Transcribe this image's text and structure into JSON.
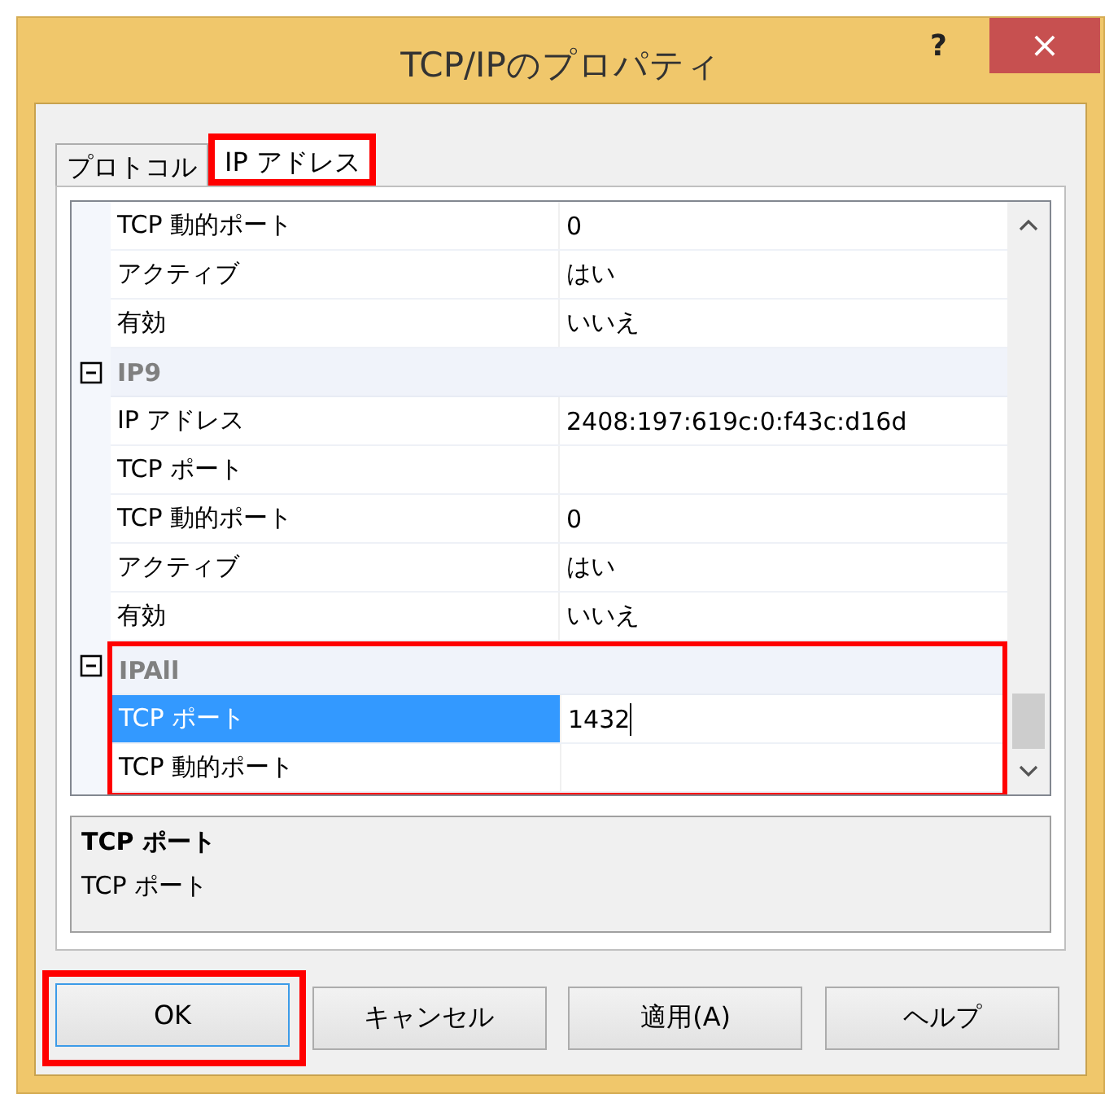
{
  "window": {
    "title": "TCP/IPのプロパティ",
    "help": "?",
    "close": "×"
  },
  "tabs": [
    {
      "label": "プロトコル",
      "selected": false,
      "highlighted": false
    },
    {
      "label": "IP アドレス",
      "selected": true,
      "highlighted": true
    }
  ],
  "grid": {
    "groups": [
      {
        "rows": [
          {
            "name": "TCP 動的ポート",
            "value": "0",
            "selected": false
          },
          {
            "name": "アクティブ",
            "value": "はい",
            "selected": false
          },
          {
            "name": "有効",
            "value": "いいえ",
            "selected": false
          }
        ]
      },
      {
        "title": "IP9",
        "expanded": true,
        "rows": [
          {
            "name": "IP アドレス",
            "value": "2408:197:619c:0:f43c:d16d",
            "selected": false
          },
          {
            "name": "TCP ポート",
            "value": "",
            "selected": false
          },
          {
            "name": "TCP 動的ポート",
            "value": "0",
            "selected": false
          },
          {
            "name": "アクティブ",
            "value": "はい",
            "selected": false
          },
          {
            "name": "有効",
            "value": "いいえ",
            "selected": false
          }
        ]
      },
      {
        "title": "IPAll",
        "expanded": true,
        "highlighted": true,
        "rows": [
          {
            "name": "TCP ポート",
            "value": "1432",
            "selected": true
          },
          {
            "name": "TCP 動的ポート",
            "value": "",
            "selected": false
          }
        ]
      }
    ]
  },
  "description": {
    "title": "TCP ポート",
    "text": "TCP ポート"
  },
  "buttons": [
    {
      "label": "OK",
      "default": true,
      "highlighted": true
    },
    {
      "label": "キャンセル",
      "default": false,
      "highlighted": false
    },
    {
      "label": "適用(A)",
      "default": false,
      "highlighted": false
    },
    {
      "label": "ヘルプ",
      "default": false,
      "highlighted": false
    }
  ]
}
